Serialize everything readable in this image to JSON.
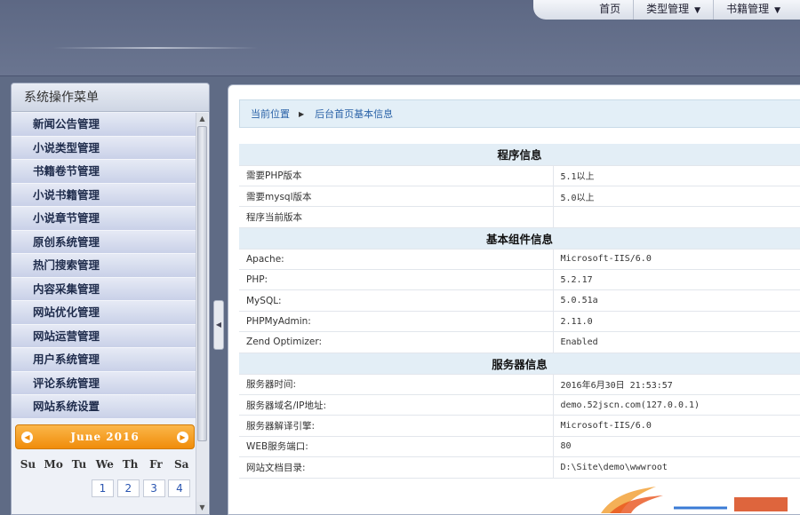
{
  "topnav": {
    "items": [
      {
        "label": "首页",
        "has_dropdown": false
      },
      {
        "label": "类型管理",
        "has_dropdown": true
      },
      {
        "label": "书籍管理",
        "has_dropdown": true
      }
    ]
  },
  "sidebar": {
    "title": "系统操作菜单",
    "items": [
      "新闻公告管理",
      "小说类型管理",
      "书籍卷节管理",
      "小说书籍管理",
      "小说章节管理",
      "原创系统管理",
      "热门搜索管理",
      "内容采集管理",
      "网站优化管理",
      "网站运营管理",
      "用户系统管理",
      "评论系统管理",
      "网站系统设置"
    ]
  },
  "calendar": {
    "month": "June 2016",
    "weekdays": [
      "Su",
      "Mo",
      "Tu",
      "We",
      "Th",
      "Fr",
      "Sa"
    ],
    "visible_days": [
      "1",
      "2",
      "3",
      "4"
    ]
  },
  "breadcrumb": {
    "label": "当前位置",
    "current": "后台首页基本信息"
  },
  "info": {
    "sections": [
      {
        "title": "程序信息",
        "rows": [
          {
            "label": "需要PHP版本",
            "value": "5.1以上"
          },
          {
            "label": "需要mysql版本",
            "value": "5.0以上"
          },
          {
            "label": "程序当前版本",
            "value": ""
          }
        ]
      },
      {
        "title": "基本组件信息",
        "rows": [
          {
            "label": "Apache:",
            "value": "Microsoft-IIS/6.0"
          },
          {
            "label": "PHP:",
            "value": "5.2.17"
          },
          {
            "label": "MySQL:",
            "value": "5.0.51a"
          },
          {
            "label": "PHPMyAdmin:",
            "value": "2.11.0"
          },
          {
            "label": "Zend Optimizer:",
            "value": "Enabled"
          }
        ]
      },
      {
        "title": "服务器信息",
        "rows": [
          {
            "label": "服务器时间:",
            "value": "2016年6月30日 21:53:57"
          },
          {
            "label": "服务器域名/IP地址:",
            "value": "demo.52jscn.com(127.0.0.1)"
          },
          {
            "label": "服务器解译引擎:",
            "value": "Microsoft-IIS/6.0"
          },
          {
            "label": "WEB服务端口:",
            "value": "80"
          },
          {
            "label": "网站文档目录:",
            "value": "D:\\Site\\demo\\wwwroot"
          }
        ]
      }
    ]
  },
  "colors": {
    "background": "#5f6b85",
    "calendar_accent": "#f08c0a",
    "link": "#2b63a8",
    "section_header": "#e3eef6"
  },
  "icons": {
    "breadcrumb_separator": "triangle-right-icon",
    "dropdown": "caret-down-icon",
    "calendar_prev": "circle-arrow-left-icon",
    "calendar_next": "circle-arrow-right-icon",
    "splitter": "triangle-left-icon"
  }
}
